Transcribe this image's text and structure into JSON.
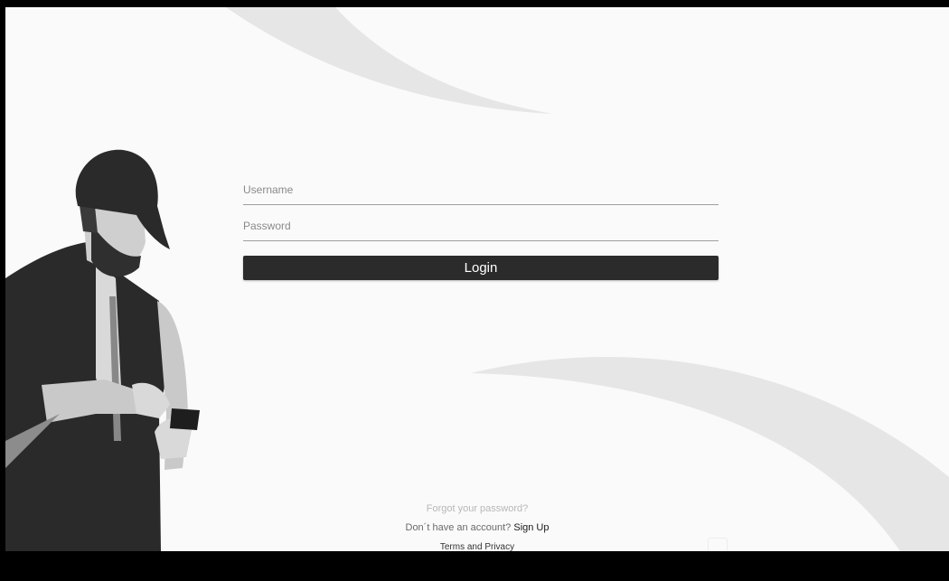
{
  "login": {
    "username_placeholder": "Username",
    "password_placeholder": "Password",
    "login_label": "Login"
  },
  "footer": {
    "forgot_password": "Forgot your password?",
    "no_account_text": "Don´t have an account?",
    "sign_up": "Sign Up",
    "terms": "Terms and Privacy"
  },
  "colors": {
    "background": "#fafafa",
    "button": "#2b2b2b",
    "swoosh": "#e6e6e6",
    "illustration_dark": "#2a2a2a",
    "illustration_light": "#c9c9c9"
  },
  "icons": {
    "illustration": "man-with-phone-illustration"
  }
}
